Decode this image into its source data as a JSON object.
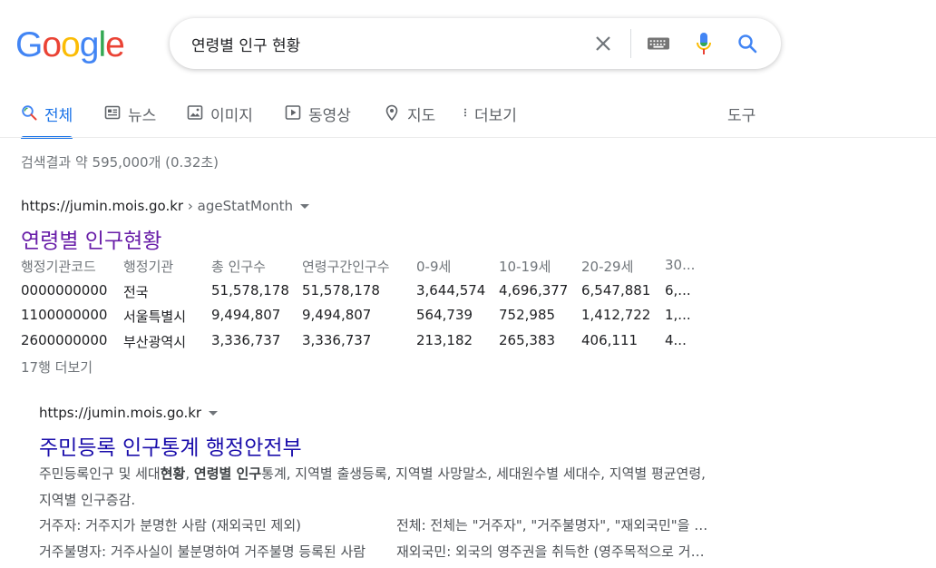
{
  "logo": {
    "letters": [
      "G",
      "o",
      "o",
      "g",
      "l",
      "e"
    ],
    "colors": [
      "#4285F4",
      "#EA4335",
      "#FBBC05",
      "#4285F4",
      "#34A853",
      "#EA4335"
    ]
  },
  "search": {
    "query": "연령별 인구 현황",
    "icons": [
      "close-icon",
      "keyboard-icon",
      "microphone-icon",
      "search-icon"
    ]
  },
  "tabs": [
    {
      "label": "전체",
      "icon": "search-icon",
      "active": true
    },
    {
      "label": "뉴스",
      "icon": "news-icon"
    },
    {
      "label": "이미지",
      "icon": "image-icon"
    },
    {
      "label": "동영상",
      "icon": "video-icon"
    },
    {
      "label": "지도",
      "icon": "map-pin-icon"
    },
    {
      "label": "더보기",
      "icon": "more-vert-icon"
    }
  ],
  "tools_label": "도구",
  "stats": "검색결과 약 595,000개 (0.32초)",
  "results": [
    {
      "url": "https://jumin.mois.go.kr",
      "path": " › ageStatMonth",
      "title": "연령별 인구현황",
      "table": {
        "headers": [
          "행정기관코드",
          "행정기관",
          "총 인구수",
          "연령구간인구수",
          "0-9세",
          "10-19세",
          "20-29세",
          "30..."
        ],
        "rows": [
          [
            "0000000000",
            "전국",
            "51,578,178",
            "51,578,178",
            "3,644,574",
            "4,696,377",
            "6,547,881",
            "6,..."
          ],
          [
            "1100000000",
            "서울특별시",
            "9,494,807",
            "9,494,807",
            "564,739",
            "752,985",
            "1,412,722",
            "1,..."
          ],
          [
            "2600000000",
            "부산광역시",
            "3,336,737",
            "3,336,737",
            "213,182",
            "265,383",
            "406,111",
            "4..."
          ]
        ],
        "more": "17행 더보기"
      }
    },
    {
      "url": "https://jumin.mois.go.kr",
      "title": "주민등록 인구통계 행정안전부",
      "snippet": [
        {
          "t": "주민등록인구 및 세대"
        },
        {
          "t": "현황",
          "b": true
        },
        {
          "t": ", "
        },
        {
          "t": "연령별 인구",
          "b": true
        },
        {
          "t": "통계, 지역별 출생등록, 지역별 사망말소, 세대원수별 세대수, 지역별 평균연령, 지역별 인구증감."
        }
      ],
      "sitelinks": [
        [
          "거주자: 거주지가 분명한 사람 (재외국민 제외)",
          "전체: 전체는 \"거주자\", \"거주불명자\", \"재외국민\"을 합한 수"
        ],
        [
          "거주불명자: 거주사실이 불분명하여 거주불명 등록된 사람",
          "재외국민: 외국의 영주권을 취득한 (영주목적으로 거주하는) 국민"
        ]
      ]
    }
  ]
}
